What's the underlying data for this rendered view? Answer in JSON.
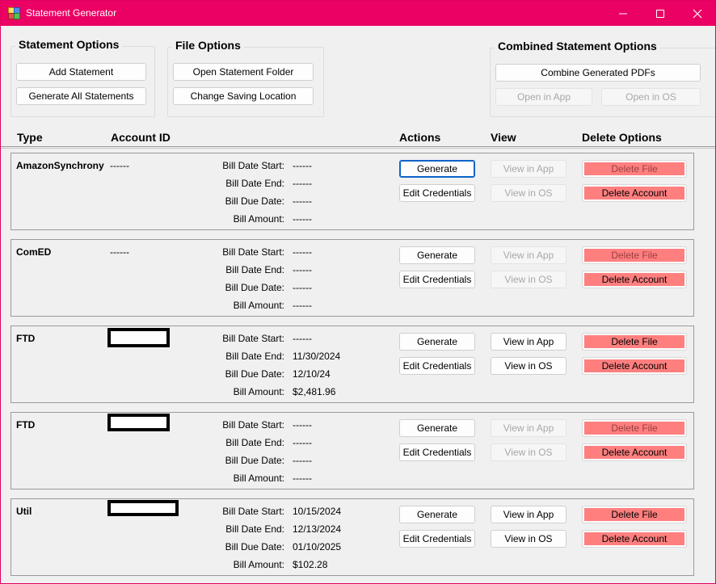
{
  "window": {
    "title": "Statement Generator"
  },
  "statement_options": {
    "title": "Statement Options",
    "add_label": "Add Statement",
    "generate_all_label": "Generate All Statements"
  },
  "file_options": {
    "title": "File Options",
    "open_folder_label": "Open Statement Folder",
    "change_location_label": "Change Saving Location"
  },
  "combined_options": {
    "title": "Combined Statement Options",
    "combine_label": "Combine Generated PDFs",
    "open_app_label": "Open in App",
    "open_os_label": "Open in OS"
  },
  "headers": {
    "type": "Type",
    "account_id": "Account ID",
    "actions": "Actions",
    "view": "View",
    "delete_options": "Delete Options"
  },
  "field_labels": {
    "start": "Bill Date Start:",
    "end": "Bill Date End:",
    "due": "Bill Due Date:",
    "amount": "Bill Amount:"
  },
  "button_labels": {
    "generate": "Generate",
    "edit_credentials": "Edit Credentials",
    "view_app": "View in App",
    "view_os": "View in OS",
    "delete_file": "Delete File",
    "delete_account": "Delete Account"
  },
  "rows": [
    {
      "type": "AmazonSynchrony",
      "account": "------",
      "start": "------",
      "end": "------",
      "due": "------",
      "amount": "------"
    },
    {
      "type": "ComED",
      "account": "------",
      "start": "------",
      "end": "------",
      "due": "------",
      "amount": "------"
    },
    {
      "type": "FTD",
      "account": "",
      "start": "------",
      "end": "11/30/2024",
      "due": "12/10/24",
      "amount": "$2,481.96"
    },
    {
      "type": "FTD",
      "account": "",
      "start": "------",
      "end": "------",
      "due": "------",
      "amount": "------"
    },
    {
      "type": "Util",
      "account": "",
      "start": "10/15/2024",
      "end": "12/13/2024",
      "due": "01/10/2025",
      "amount": "$102.28"
    }
  ],
  "colors": {
    "titlebar": "#eb0064",
    "delete_button": "#ff7f7f",
    "focus": "#0a64c8"
  }
}
